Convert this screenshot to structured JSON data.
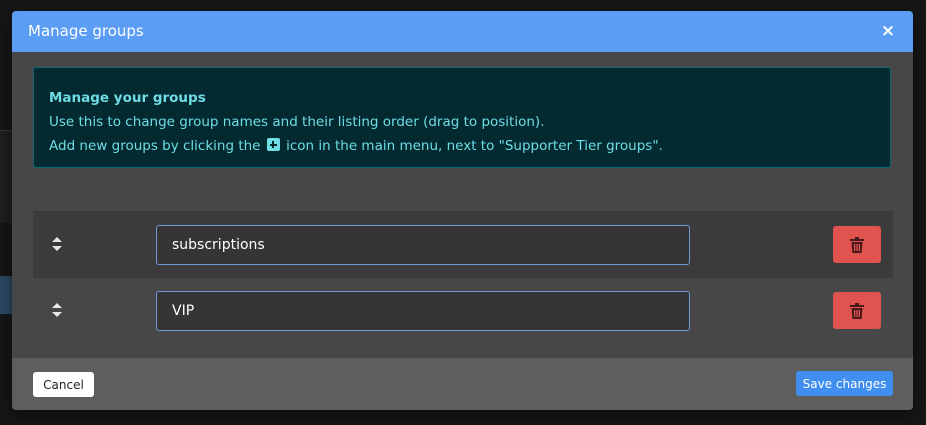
{
  "modal": {
    "title": "Manage groups",
    "close_symbol": "×"
  },
  "info": {
    "title": "Manage your groups",
    "line1": "Use this to change group names and their listing order (drag to position).",
    "line2_before": "Add new groups by clicking the",
    "line2_icon": "plus-square-icon",
    "line2_after": "icon in the main menu, next to \"Supporter Tier groups\"."
  },
  "groups": [
    {
      "name": "subscriptions"
    },
    {
      "name": "VIP"
    }
  ],
  "footer": {
    "cancel_label": "Cancel",
    "save_label": "Save changes"
  },
  "colors": {
    "header_blue": "#5b9cf5",
    "info_text": "#6fdde6",
    "delete_red": "#e0534f",
    "save_blue": "#3f8ef0"
  }
}
